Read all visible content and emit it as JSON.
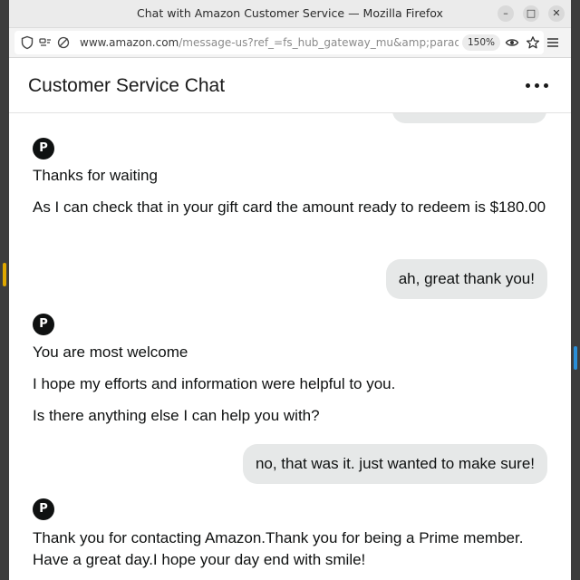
{
  "browser": {
    "window_title": "Chat with Amazon Customer Service — Mozilla Firefox",
    "url_host": "www.amazon.com",
    "url_path": "/message-us?ref_=fs_hub_gateway_mu&amp;paradigm",
    "zoom": "150%",
    "accent_color": "#e8a900"
  },
  "header": {
    "title": "Customer Service Chat"
  },
  "chat": {
    "agent_avatar_letter": "P",
    "messages": [
      {
        "from": "agent",
        "lines": [
          "Thanks for waiting",
          "As I can check that in your gift card the amount ready to redeem is $180.00"
        ]
      },
      {
        "from": "user",
        "text": "ah, great thank you!"
      },
      {
        "from": "agent",
        "lines": [
          "You are most welcome",
          "I hope my efforts and information were helpful to you.",
          "Is there anything else I can help you with?"
        ]
      },
      {
        "from": "user",
        "text": "no, that was it. just wanted to make sure!"
      },
      {
        "from": "agent",
        "lines": [
          "Thank you for contacting Amazon.Thank you for being a Prime member. Have a great day.I hope your day end with smile!"
        ]
      }
    ]
  }
}
